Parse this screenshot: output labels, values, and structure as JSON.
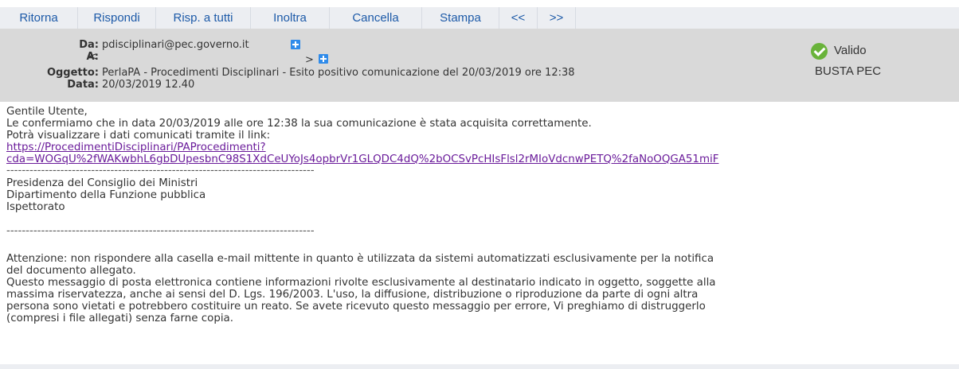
{
  "toolbar": {
    "reply_back": "Ritorna",
    "reply": "Rispondi",
    "reply_all": "Risp. a tutti",
    "forward": "Inoltra",
    "delete": "Cancella",
    "print": "Stampa",
    "prev": "<<",
    "next": ">>"
  },
  "header": {
    "from_label": "Da:",
    "from_value": "pdisciplinari@pec.governo.it",
    "to_label": "A:",
    "to_open": "<",
    "to_close": ">",
    "subject_label": "Oggetto:",
    "subject_value": "PerlaPA - Procedimenti Disciplinari - Esito positivo comunicazione del 20/03/2019 ore 12:38",
    "date_label": "Data:",
    "date_value": "20/03/2019 12.40",
    "status_label": "Valido",
    "envelope_label": "BUSTA PEC",
    "icons": {
      "add": "plus-icon",
      "status": "check-circle-icon"
    },
    "colors": {
      "status_ok": "#69b33a",
      "add_icon": "#2f8bea"
    }
  },
  "message": {
    "greeting": "Gentile Utente,",
    "line1": "Le confermiamo che in data 20/03/2019 alle ore 12:38 la sua comunicazione è stata acquisita correttamente.",
    "line2": "Potrà visualizzare i dati comunicati tramite il link:",
    "link_line1": "https://ProcedimentiDisciplinari/PAProcedimenti?",
    "link_line2": "cda=WOGqU%2fWAKwbhL6gbDUpesbnC98S1XdCeUYoJs4opbrVr1GLQDC4dQ%2bOCSvPcHIsFlsl2rMIoVdcnwPETQ%2faNoOQGA51miF",
    "separator1": "--------------------------------------------------------------------------------",
    "org1": "Presidenza del Consiglio dei Ministri",
    "org2": "Dipartimento della Funzione pubblica",
    "org3": "Ispettorato",
    "separator2": "--------------------------------------------------------------------------------",
    "warn1": "Attenzione: non rispondere alla casella e-mail mittente in quanto è utilizzata da sistemi automatizzati esclusivamente per la notifica",
    "warn2": "del documento allegato.",
    "conf1": "Questo messaggio di posta elettronica contiene informazioni rivolte esclusivamente al destinatario indicato in oggetto, soggette alla",
    "conf2": "massima riservatezza, anche ai sensi del D. Lgs. 196/2003. L'uso, la diffusione, distribuzione o riproduzione da parte di ogni altra",
    "conf3": "persona sono vietati e potrebbero costituire un reato. Se avete ricevuto questo messaggio per errore, Vi preghiamo di distruggerlo",
    "conf4": "(compresi i file allegati) senza farne copia."
  }
}
